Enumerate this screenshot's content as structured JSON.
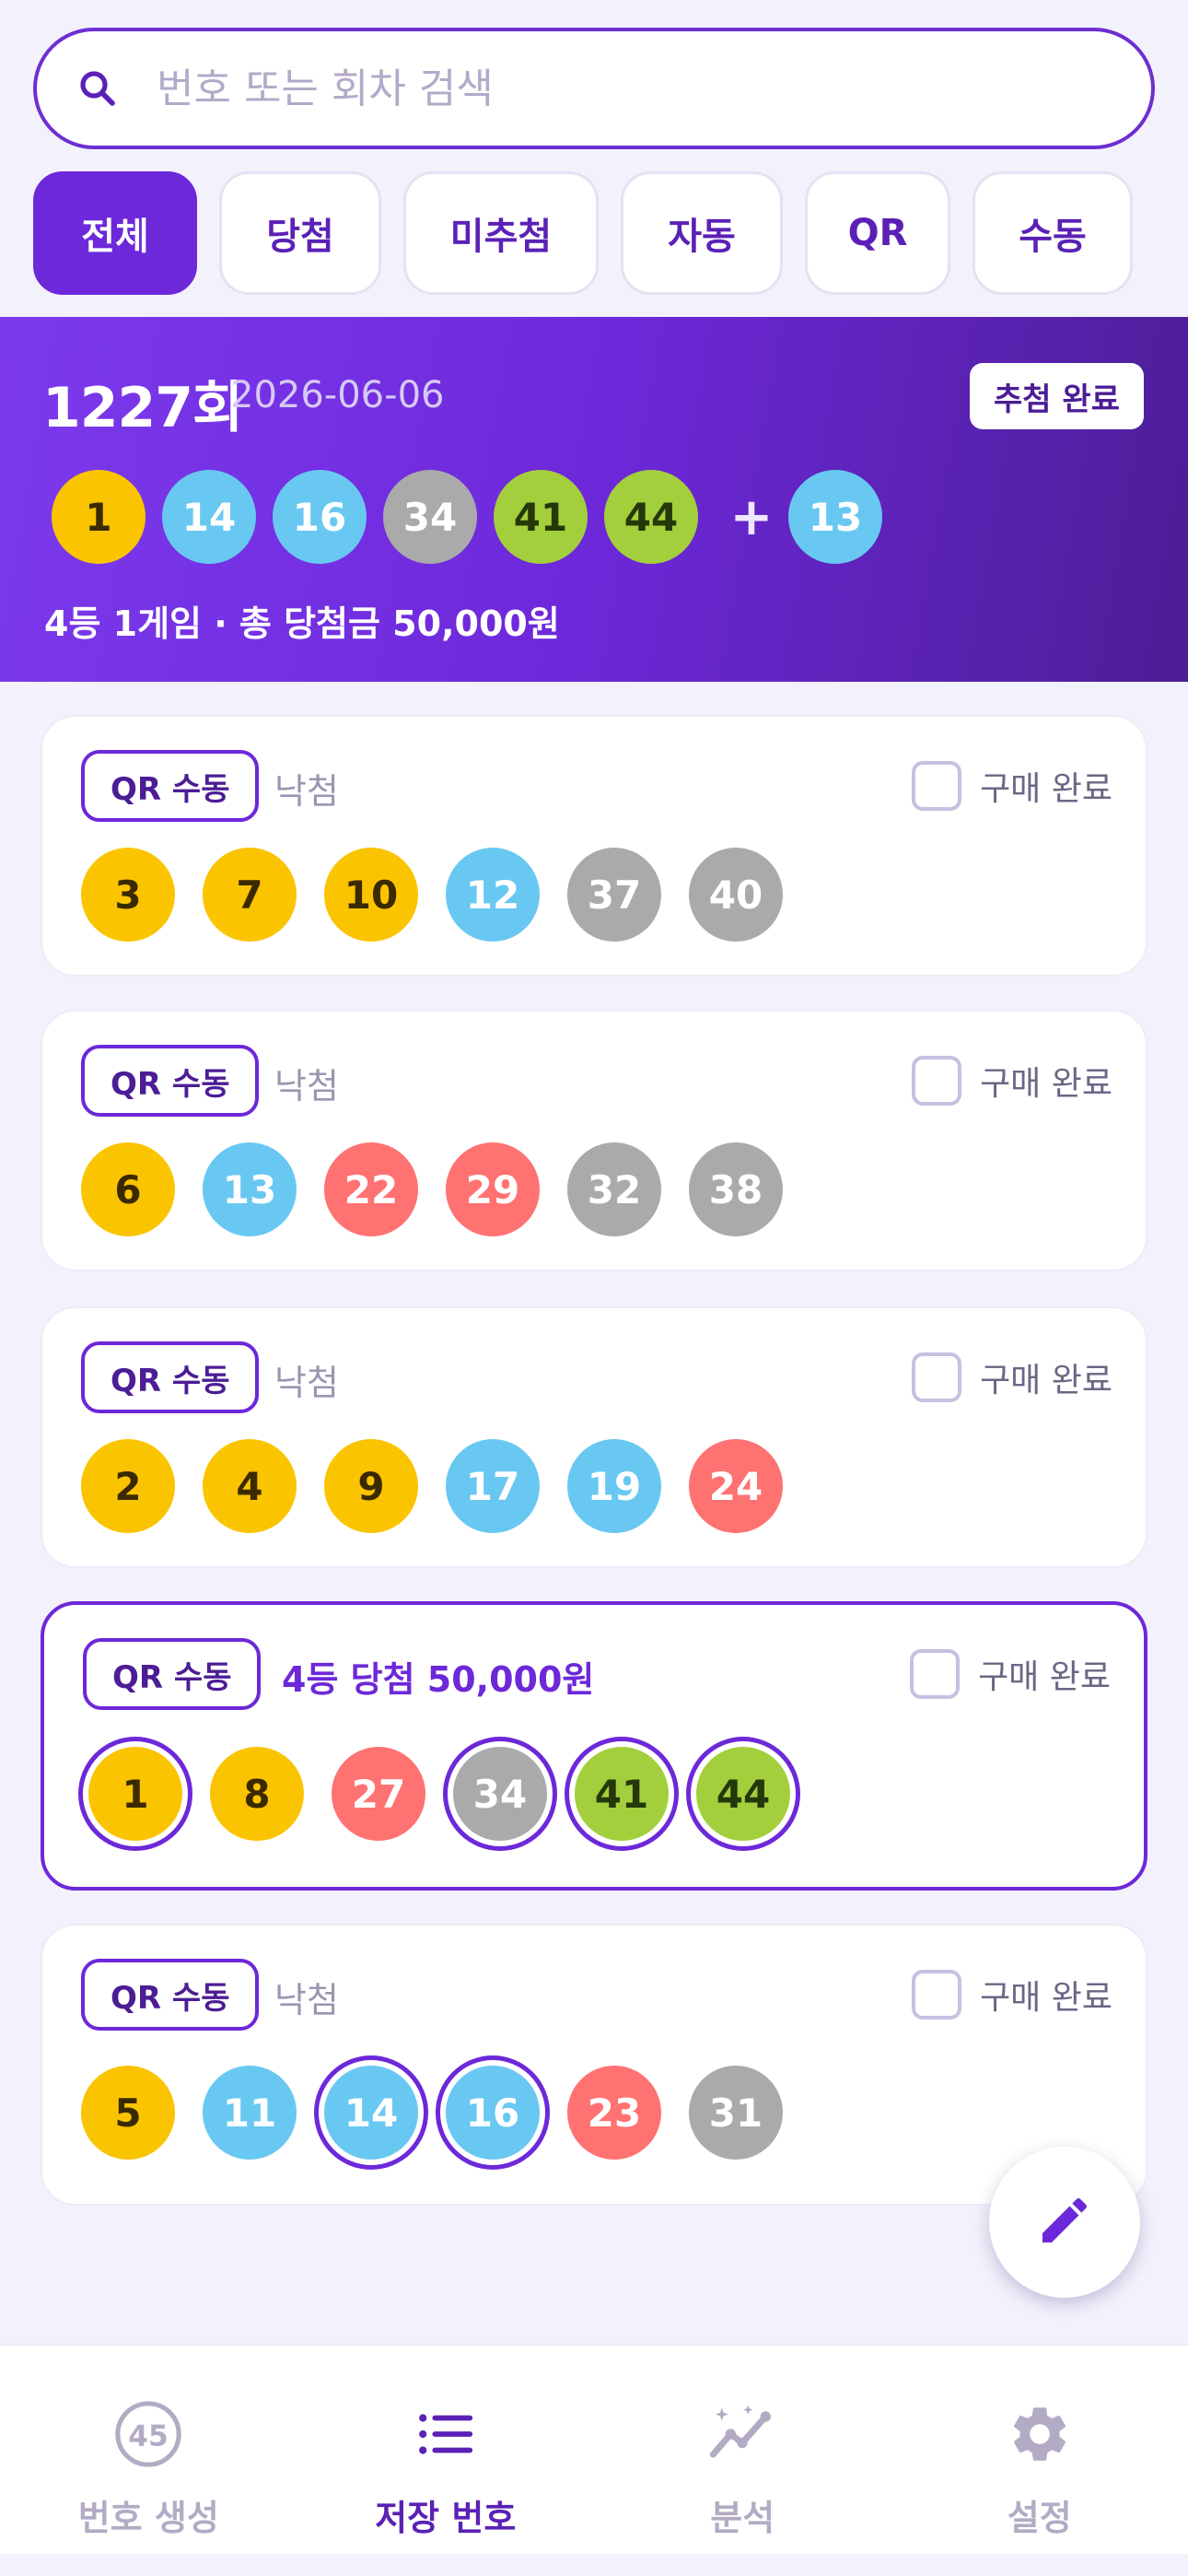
{
  "search": {
    "placeholder": "번호 또는 회차 검색",
    "icon": "search-icon"
  },
  "filters": [
    {
      "label": "전체",
      "active": true
    },
    {
      "label": "당첨",
      "active": false
    },
    {
      "label": "미추첨",
      "active": false
    },
    {
      "label": "자동",
      "active": false
    },
    {
      "label": "QR",
      "active": false
    },
    {
      "label": "수동",
      "active": false
    }
  ],
  "draw": {
    "round": "1227회",
    "date": "2026-06-06",
    "status": "추첨 완료",
    "numbers": [
      1,
      14,
      16,
      34,
      41,
      44
    ],
    "plus": "+",
    "bonus": 13,
    "summary": "4등 1게임 · 총 당첨금 50,000원"
  },
  "tickets": [
    {
      "tag": "QR 수동",
      "result": "낙첨",
      "won": false,
      "purchase_label": "구매 완료",
      "purchased": false,
      "numbers": [
        3,
        7,
        10,
        12,
        37,
        40
      ]
    },
    {
      "tag": "QR 수동",
      "result": "낙첨",
      "won": false,
      "purchase_label": "구매 완료",
      "purchased": false,
      "numbers": [
        6,
        13,
        22,
        29,
        32,
        38
      ]
    },
    {
      "tag": "QR 수동",
      "result": "낙첨",
      "won": false,
      "purchase_label": "구매 완료",
      "purchased": false,
      "numbers": [
        2,
        4,
        9,
        17,
        19,
        24
      ]
    },
    {
      "tag": "QR 수동",
      "result": "4등 당첨 50,000원",
      "won": true,
      "purchase_label": "구매 완료",
      "purchased": false,
      "numbers": [
        1,
        8,
        27,
        34,
        41,
        44
      ]
    },
    {
      "tag": "QR 수동",
      "result": "낙첨",
      "won": false,
      "purchase_label": "구매 완료",
      "purchased": false,
      "numbers": [
        5,
        11,
        14,
        16,
        23,
        31
      ]
    }
  ],
  "fab": {
    "icon": "pencil-icon"
  },
  "nav": [
    {
      "label": "번호 생성",
      "icon": "lotto-ball-45-icon",
      "icon_text": "45",
      "active": false
    },
    {
      "label": "저장 번호",
      "icon": "list-icon",
      "active": true
    },
    {
      "label": "분석",
      "icon": "analytics-sparkle-icon",
      "active": false
    },
    {
      "label": "설정",
      "icon": "gear-icon",
      "active": false
    }
  ],
  "colors": {
    "accent": "#6d28d9",
    "ball_1_10": "#fbc400",
    "ball_11_20": "#69c8f2",
    "ball_21_30": "#ff7272",
    "ball_31_40": "#aaaaaa",
    "ball_41_45": "#a3cf3c"
  }
}
